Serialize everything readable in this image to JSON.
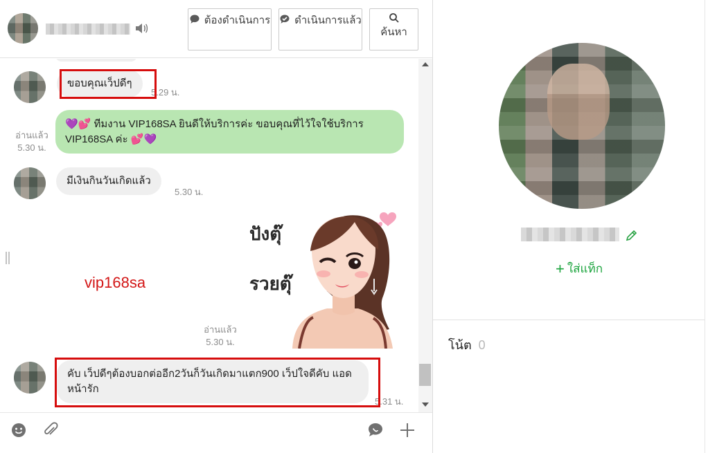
{
  "header": {
    "todo_label": "ต้องดำเนินการ",
    "done_label": "ดำเนินการแล้ว",
    "search_label": "ค้นหา"
  },
  "messages": [
    {
      "text": "ขอบคุณเว็ปดีๆ",
      "time": "5.29 น."
    },
    {
      "text": "💜💕 ทีมงาน VIP168SA ยินดีให้บริการค่ะ ขอบคุณที่ไว้ใจใช้บริการ VIP168SA ค่ะ 💕💜",
      "read": "อ่านแล้ว",
      "time": "5.30 น."
    },
    {
      "text": "มีเงินกินวันเกิดแล้ว",
      "time": "5.30 น."
    },
    {
      "sticker_text_1": "ปังตุ๊",
      "sticker_text_2": "รวยตุ๊",
      "read": "อ่านแล้ว",
      "time": "5.30 น."
    },
    {
      "text": "คับ เว็ปดีๆต้องบอกต่ออีก2วันก็วันเกิดมาแตก900 เว็ปใจดีคับ แอดหน้ารัก",
      "time": "5.31 น."
    }
  ],
  "watermark": "vip168sa",
  "profile": {
    "add_tag_label": "ใส่แท็ก",
    "note_label": "โน้ต",
    "note_count": "0"
  },
  "colors": {
    "outgoing_bubble": "#b9e6b2",
    "incoming_bubble": "#efefef",
    "highlight_box": "#d60d0d",
    "tag_green": "#1aa33c"
  }
}
